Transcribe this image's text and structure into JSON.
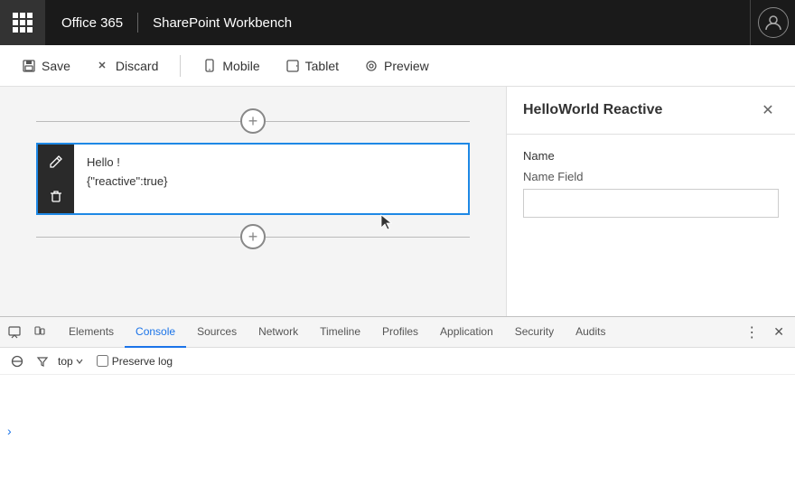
{
  "topbar": {
    "app_title": "Office 365",
    "divider": "|",
    "page_title": "SharePoint Workbench"
  },
  "toolbar": {
    "save_label": "Save",
    "discard_label": "Discard",
    "mobile_label": "Mobile",
    "tablet_label": "Tablet",
    "preview_label": "Preview"
  },
  "webpart": {
    "line1": "Hello !",
    "line2": "{\"reactive\":true}"
  },
  "panel": {
    "title": "HelloWorld Reactive",
    "name_label": "Name",
    "name_field_label": "Name Field",
    "name_field_placeholder": ""
  },
  "devtools": {
    "tabs": [
      {
        "label": "Elements",
        "active": false
      },
      {
        "label": "Console",
        "active": true
      },
      {
        "label": "Sources",
        "active": false
      },
      {
        "label": "Network",
        "active": false
      },
      {
        "label": "Timeline",
        "active": false
      },
      {
        "label": "Profiles",
        "active": false
      },
      {
        "label": "Application",
        "active": false
      },
      {
        "label": "Security",
        "active": false
      },
      {
        "label": "Audits",
        "active": false
      }
    ],
    "filter_top": "top",
    "preserve_log_label": "Preserve log",
    "more_icon": "⋮",
    "close_icon": "✕"
  }
}
